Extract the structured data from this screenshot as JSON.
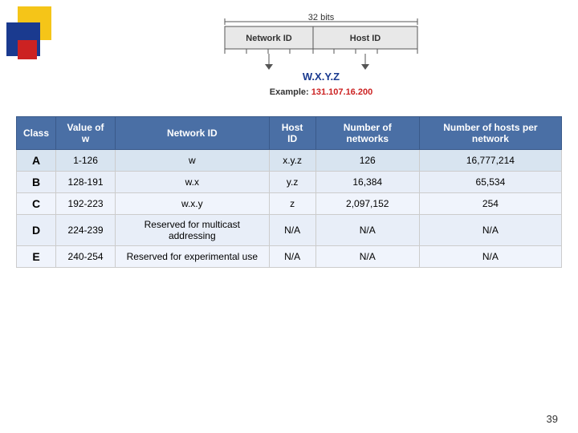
{
  "deco": {
    "colors": {
      "yellow": "#f5c518",
      "blue": "#1a3a8f",
      "red": "#cc2222"
    }
  },
  "diagram": {
    "bits_label": "32 bits",
    "network_id_label": "Network ID",
    "host_id_label": "Host ID",
    "example_label": "Example: 131.107.16.200",
    "address_example": "W.X.Y.Z"
  },
  "table": {
    "headers": [
      "Class",
      "Value of w",
      "Network ID",
      "Host ID",
      "Number of networks",
      "Number of hosts per network"
    ],
    "rows": [
      {
        "class": "A",
        "value_w": "1-126",
        "network_id": "w",
        "host_id": "x.y.z",
        "num_networks": "126",
        "hosts_per_network": "16,777,214"
      },
      {
        "class": "B",
        "value_w": "128-191",
        "network_id": "w.x",
        "host_id": "y.z",
        "num_networks": "16,384",
        "hosts_per_network": "65,534"
      },
      {
        "class": "C",
        "value_w": "192-223",
        "network_id": "w.x.y",
        "host_id": "z",
        "num_networks": "2,097,152",
        "hosts_per_network": "254"
      },
      {
        "class": "D",
        "value_w": "224-239",
        "network_id": "Reserved for multicast addressing",
        "host_id": "N/A",
        "num_networks": "N/A",
        "hosts_per_network": "N/A"
      },
      {
        "class": "E",
        "value_w": "240-254",
        "network_id": "Reserved for experimental use",
        "host_id": "N/A",
        "num_networks": "N/A",
        "hosts_per_network": "N/A"
      }
    ]
  },
  "page_number": "39"
}
